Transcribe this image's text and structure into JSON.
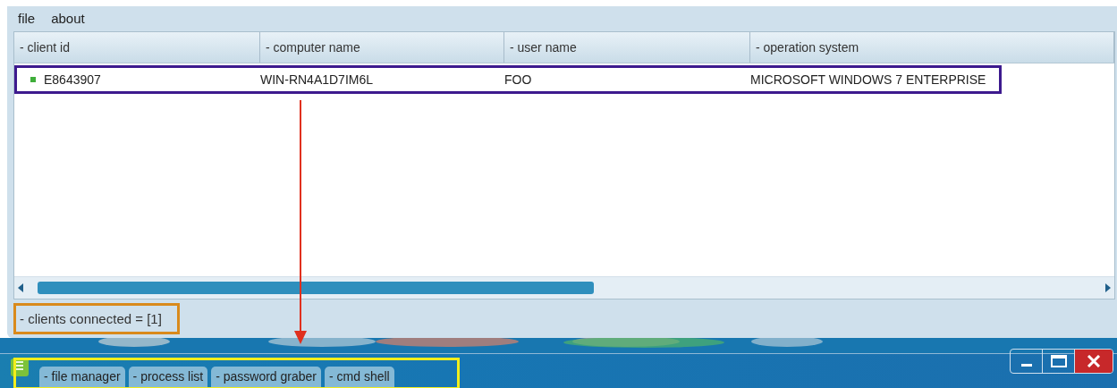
{
  "menu": [
    {
      "label": "file"
    },
    {
      "label": "about"
    }
  ],
  "table": {
    "columns": [
      "- client id",
      "- computer name",
      "- user name",
      "- operation system"
    ],
    "rows": [
      {
        "cells": [
          "E8643907",
          "WIN-RN4A1D7IM6L",
          "FOO",
          "MICROSOFT WINDOWS 7 ENTERPRISE"
        ]
      }
    ]
  },
  "status_bar": "- clients connected = [1]",
  "tabs": [
    {
      "label": "- file manager"
    },
    {
      "label": "- process list"
    },
    {
      "label": "- password graber"
    },
    {
      "label": "- cmd shell"
    }
  ]
}
